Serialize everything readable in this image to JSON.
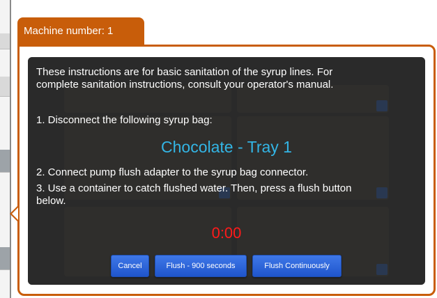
{
  "dialog": {
    "title": "Machine number: 1",
    "intro_line1": "These instructions are for basic sanitation of the syrup lines. For",
    "intro_line2": "complete sanitation instructions, consult your operator's manual.",
    "step1": "1. Disconnect the following syrup bag:",
    "syrup_name": "Chocolate - Tray 1",
    "step2": "2. Connect pump flush adapter to the syrup bag connector.",
    "step3_line1": "3. Use a container to catch flushed water. Then, press a flush button",
    "step3_line2": "below.",
    "timer": "0:00"
  },
  "buttons": {
    "cancel": "Cancel",
    "flush_900": "Flush - 900 seconds",
    "flush_continuous": "Flush Continuously"
  },
  "colors": {
    "accent": "#c85d0a",
    "syrup_text": "#33b5e5",
    "timer_text": "#ff1a1a",
    "button": "#2a62d6"
  }
}
